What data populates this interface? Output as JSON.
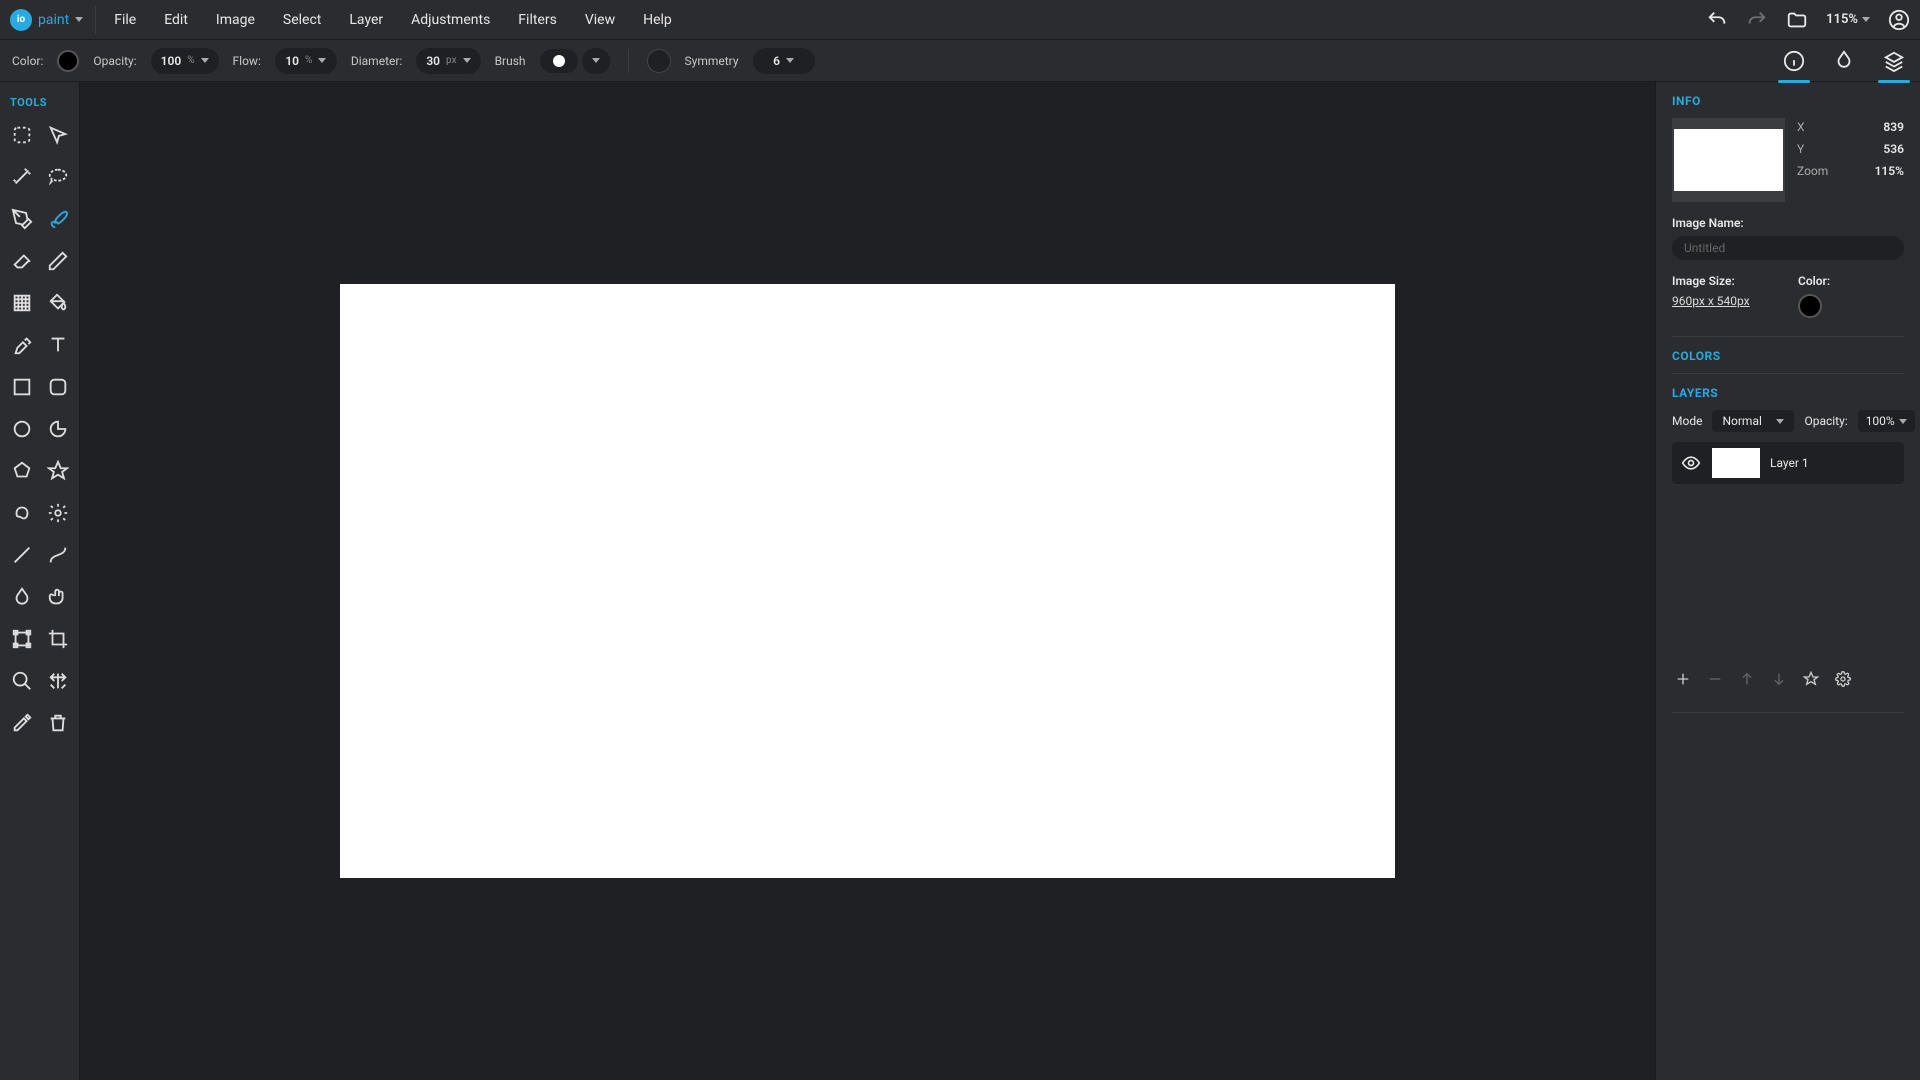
{
  "app": {
    "name": "paint"
  },
  "menu": [
    "File",
    "Edit",
    "Image",
    "Select",
    "Layer",
    "Adjustments",
    "Filters",
    "View",
    "Help"
  ],
  "topbar": {
    "zoom": "115%"
  },
  "options": {
    "color_label": "Color:",
    "opacity_label": "Opacity:",
    "opacity_value": "100",
    "flow_label": "Flow:",
    "flow_value": "10",
    "diameter_label": "Diameter:",
    "diameter_value": "30",
    "diameter_unit": "px",
    "brush_label": "Brush",
    "symmetry_label": "Symmetry",
    "symmetry_value": "6",
    "percent": "%"
  },
  "tools_header": "TOOLS",
  "info": {
    "title": "INFO",
    "x_label": "X",
    "x_value": "839",
    "y_label": "Y",
    "y_value": "536",
    "zoom_label": "Zoom",
    "zoom_value": "115%",
    "image_name_label": "Image Name:",
    "image_name_placeholder": "Untitled",
    "image_size_label": "Image Size:",
    "image_size_value": "960px x 540px",
    "color_label": "Color:"
  },
  "colors": {
    "title": "COLORS"
  },
  "layers": {
    "title": "LAYERS",
    "mode_label": "Mode",
    "mode_value": "Normal",
    "opacity_label": "Opacity:",
    "opacity_value": "100%",
    "items": [
      {
        "name": "Layer 1"
      }
    ]
  }
}
